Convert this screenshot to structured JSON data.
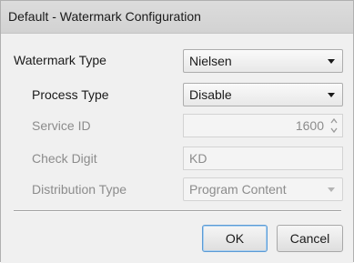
{
  "window": {
    "title": "Default - Watermark Configuration"
  },
  "form": {
    "watermark_type": {
      "label": "Watermark Type",
      "value": "Nielsen",
      "enabled": true
    },
    "process_type": {
      "label": "Process Type",
      "value": "Disable",
      "enabled": true
    },
    "service_id": {
      "label": "Service ID",
      "value": "1600",
      "enabled": false
    },
    "check_digit": {
      "label": "Check Digit",
      "value": "KD",
      "enabled": false
    },
    "distribution_type": {
      "label": "Distribution Type",
      "value": "Program Content",
      "enabled": false
    }
  },
  "buttons": {
    "ok_label": "OK",
    "cancel_label": "Cancel"
  },
  "icons": {
    "dropdown": "chevron-down-icon",
    "spin_up": "chevron-up-icon",
    "spin_down": "chevron-down-icon"
  }
}
